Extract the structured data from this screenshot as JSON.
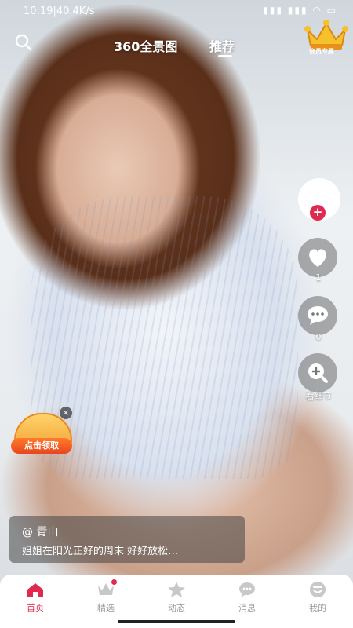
{
  "status_bar": {
    "time": "10:19",
    "network": "40.4K/s",
    "icons_text": "▮▮▮ ▮▮▮ ◠ ▭"
  },
  "top_nav": {
    "tabs": [
      {
        "label": "360全景图",
        "active": false
      },
      {
        "label": "推荐",
        "active": true
      }
    ],
    "crown_badge_label": "会员专属"
  },
  "actions": {
    "like_count": "1",
    "comment_count": "0",
    "detail_label": "看细节"
  },
  "promo": {
    "button_label": "点击领取",
    "close_glyph": "×"
  },
  "caption": {
    "author": "@ 青山",
    "description": "姐姐在阳光正好的周末 好好放松…"
  },
  "tab_bar": {
    "items": [
      {
        "label": "首页",
        "icon": "home-icon",
        "active": true
      },
      {
        "label": "精选",
        "icon": "crown-icon",
        "active": false,
        "badge_dot": true
      },
      {
        "label": "动态",
        "icon": "star-icon",
        "active": false
      },
      {
        "label": "消息",
        "icon": "message-icon",
        "active": false
      },
      {
        "label": "我的",
        "icon": "profile-icon",
        "active": false
      }
    ]
  },
  "colors": {
    "accent": "#e0294e",
    "inactive_tab": "#999999"
  }
}
